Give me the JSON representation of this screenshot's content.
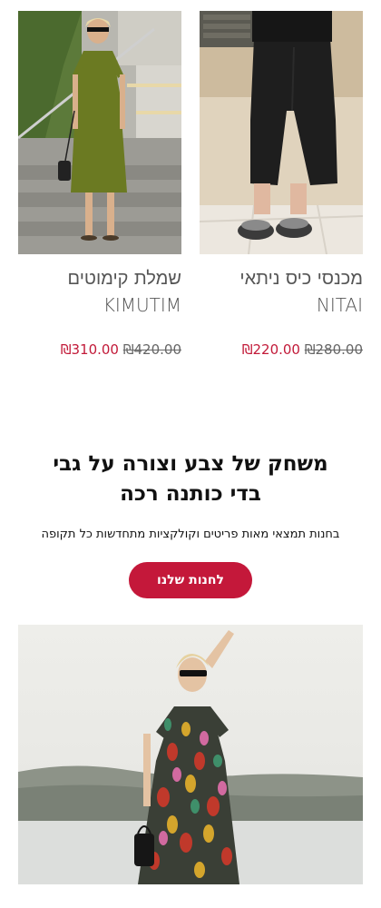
{
  "products": [
    {
      "name_he": "מכנסי כיס ניתאי",
      "name_en": "NITAI",
      "sale_price": "₪220.00",
      "old_price": "₪280.00",
      "image": "black-wide-pants-photo"
    },
    {
      "name_he": "שמלת קימוטים",
      "name_en": "KIMUTIM",
      "sale_price": "₪310.00",
      "old_price": "₪420.00",
      "image": "olive-dress-photo"
    }
  ],
  "promo": {
    "title": "משחק של צבע וצורה על גבי בדי כותנה רכה",
    "subtitle": "בחנות תמצאי מאות פריטים וקולקציות מתחדשות כל תקופה",
    "button_label": "לחנות שלנו"
  },
  "banner": {
    "image": "patterned-dress-model-photo"
  },
  "colors": {
    "accent": "#c4183a",
    "sale": "#c21a39"
  }
}
